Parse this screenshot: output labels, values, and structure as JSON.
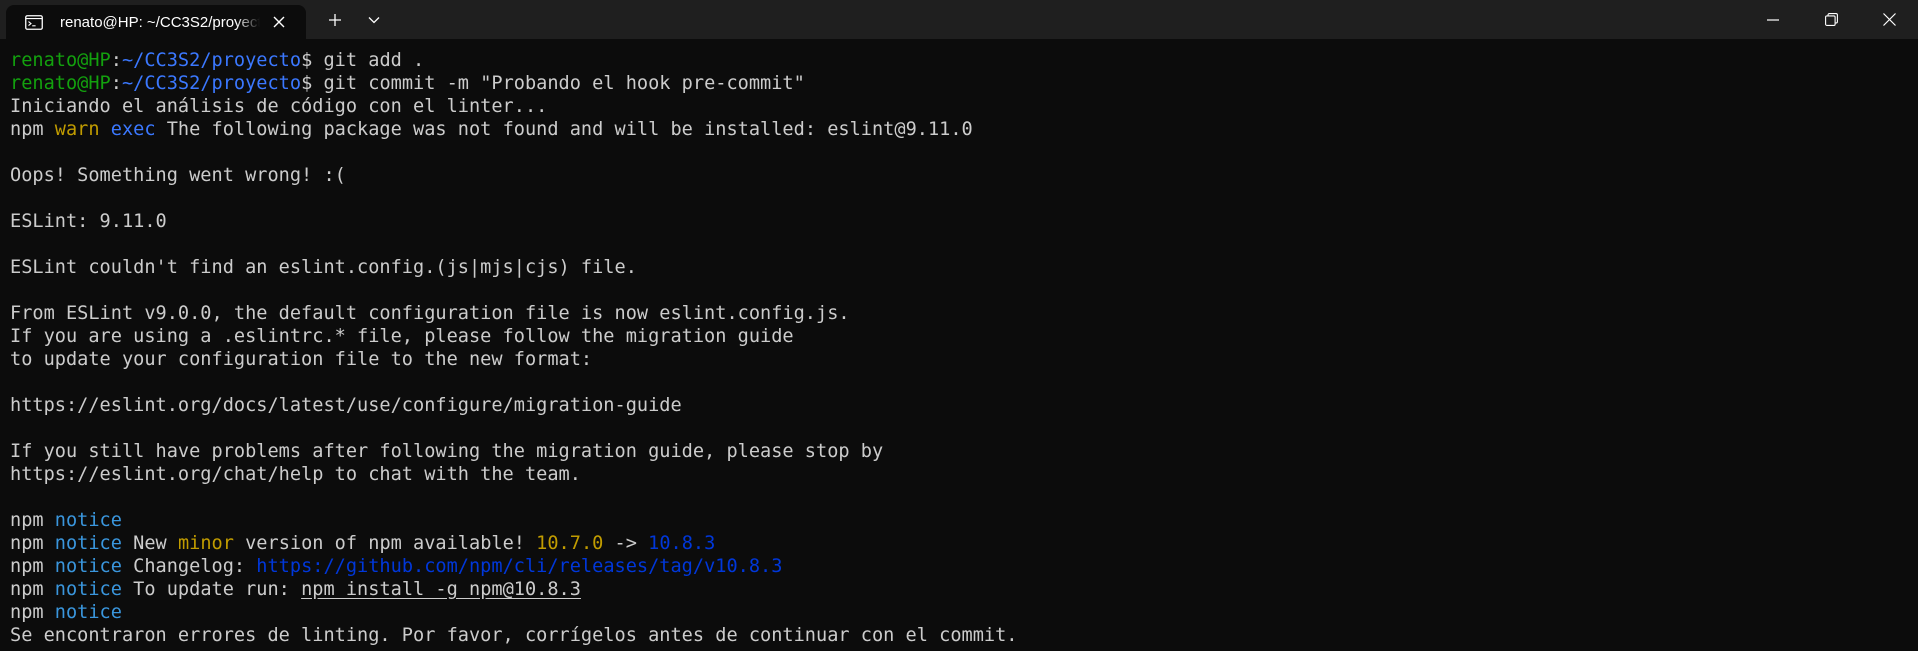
{
  "tab": {
    "title": "renato@HP: ~/CC3S2/proyecto",
    "icon": "terminal-icon"
  },
  "colors": {
    "background": "#0c0c0c",
    "titlebar": "#1f1f1f",
    "text": "#cccccc",
    "prompt_user": "#13a10e",
    "prompt_path": "#3b78ff",
    "warn": "#c19c00",
    "exec": "#3b78ff",
    "notice": "#3a96dd",
    "minor": "#c19c00",
    "version_old": "#c19c00",
    "version_new": "#0037da",
    "link": "#0037da"
  },
  "terminal": {
    "lines": [
      {
        "segments": [
          {
            "t": "renato@HP",
            "c": "prompt_user"
          },
          {
            "t": ":",
            "c": "text"
          },
          {
            "t": "~/CC3S2/proyecto",
            "c": "prompt_path"
          },
          {
            "t": "$ git add .",
            "c": "text"
          }
        ]
      },
      {
        "segments": [
          {
            "t": "renato@HP",
            "c": "prompt_user"
          },
          {
            "t": ":",
            "c": "text"
          },
          {
            "t": "~/CC3S2/proyecto",
            "c": "prompt_path"
          },
          {
            "t": "$ git commit -m \"Probando el hook pre-commit\"",
            "c": "text"
          }
        ]
      },
      {
        "segments": [
          {
            "t": "Iniciando el análisis de código con el linter...",
            "c": "text"
          }
        ]
      },
      {
        "segments": [
          {
            "t": "npm ",
            "c": "text"
          },
          {
            "t": "warn",
            "c": "warn"
          },
          {
            "t": " ",
            "c": "text"
          },
          {
            "t": "exec",
            "c": "exec"
          },
          {
            "t": " The following package was not found and will be installed: eslint@9.11.0",
            "c": "text"
          }
        ]
      },
      {
        "segments": []
      },
      {
        "segments": [
          {
            "t": "Oops! Something went wrong! :(",
            "c": "text"
          }
        ]
      },
      {
        "segments": []
      },
      {
        "segments": [
          {
            "t": "ESLint: 9.11.0",
            "c": "text"
          }
        ]
      },
      {
        "segments": []
      },
      {
        "segments": [
          {
            "t": "ESLint couldn't find an eslint.config.(js|mjs|cjs) file.",
            "c": "text"
          }
        ]
      },
      {
        "segments": []
      },
      {
        "segments": [
          {
            "t": "From ESLint v9.0.0, the default configuration file is now eslint.config.js.",
            "c": "text"
          }
        ]
      },
      {
        "segments": [
          {
            "t": "If you are using a .eslintrc.* file, please follow the migration guide",
            "c": "text"
          }
        ]
      },
      {
        "segments": [
          {
            "t": "to update your configuration file to the new format:",
            "c": "text"
          }
        ]
      },
      {
        "segments": []
      },
      {
        "segments": [
          {
            "t": "https://eslint.org/docs/latest/use/configure/migration-guide",
            "c": "text"
          }
        ]
      },
      {
        "segments": []
      },
      {
        "segments": [
          {
            "t": "If you still have problems after following the migration guide, please stop by",
            "c": "text"
          }
        ]
      },
      {
        "segments": [
          {
            "t": "https://eslint.org/chat/help to chat with the team.",
            "c": "text"
          }
        ]
      },
      {
        "segments": []
      },
      {
        "segments": [
          {
            "t": "npm ",
            "c": "text"
          },
          {
            "t": "notice",
            "c": "notice"
          }
        ]
      },
      {
        "segments": [
          {
            "t": "npm ",
            "c": "text"
          },
          {
            "t": "notice",
            "c": "notice"
          },
          {
            "t": " New ",
            "c": "text"
          },
          {
            "t": "minor",
            "c": "minor"
          },
          {
            "t": " version of npm available! ",
            "c": "text"
          },
          {
            "t": "10.7.0",
            "c": "version_old"
          },
          {
            "t": " -> ",
            "c": "text"
          },
          {
            "t": "10.8.3",
            "c": "version_new"
          }
        ]
      },
      {
        "segments": [
          {
            "t": "npm ",
            "c": "text"
          },
          {
            "t": "notice",
            "c": "notice"
          },
          {
            "t": " Changelog: ",
            "c": "text"
          },
          {
            "t": "https://github.com/npm/cli/releases/tag/v10.8.3",
            "c": "link"
          }
        ]
      },
      {
        "segments": [
          {
            "t": "npm ",
            "c": "text"
          },
          {
            "t": "notice",
            "c": "notice"
          },
          {
            "t": " To update run: ",
            "c": "text"
          },
          {
            "t": "npm install -g npm@10.8.3",
            "c": "text",
            "u": true
          }
        ]
      },
      {
        "segments": [
          {
            "t": "npm ",
            "c": "text"
          },
          {
            "t": "notice",
            "c": "notice"
          }
        ]
      },
      {
        "segments": [
          {
            "t": "Se encontraron errores de linting. Por favor, corrígelos antes de continuar con el commit.",
            "c": "text"
          }
        ]
      }
    ]
  }
}
